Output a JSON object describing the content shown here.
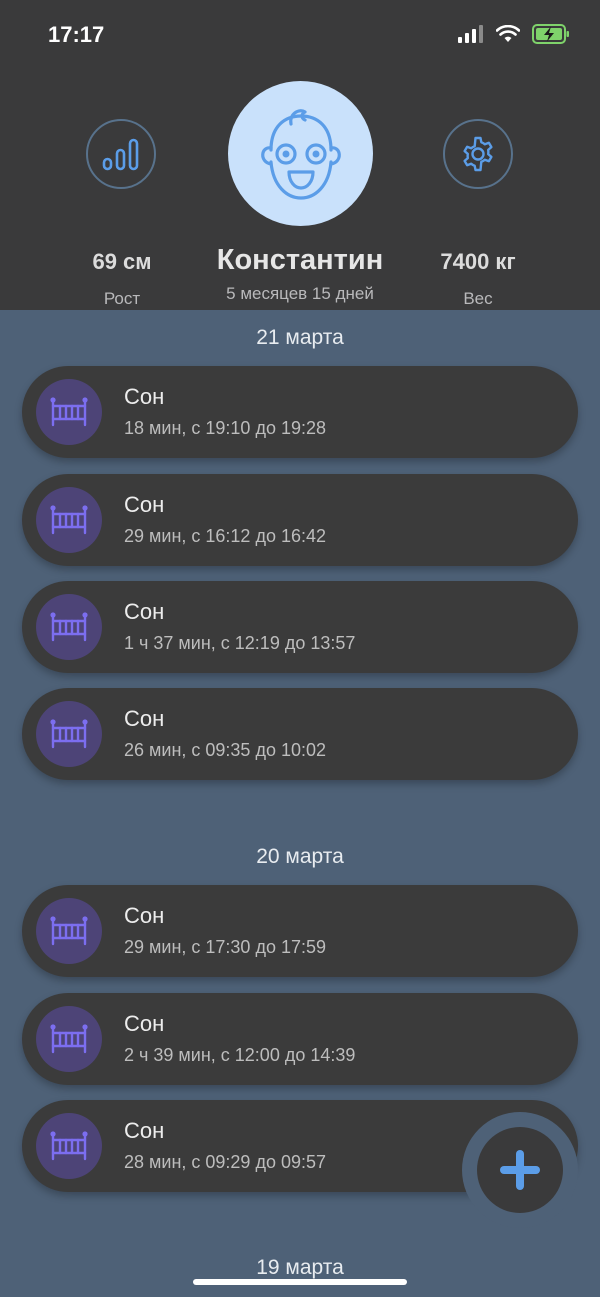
{
  "status": {
    "time": "17:17"
  },
  "profile": {
    "name": "Константин",
    "age": "5 месяцев 15 дней",
    "height_value": "69 см",
    "height_label": "Рост",
    "weight_value": "7400 кг",
    "weight_label": "Вес"
  },
  "groups": [
    {
      "date": "21 марта",
      "items": [
        {
          "title": "Сон",
          "detail": "18 мин, с 19:10 до 19:28"
        },
        {
          "title": "Сон",
          "detail": "29 мин, с 16:12 до 16:42"
        },
        {
          "title": "Сон",
          "detail": "1 ч 37 мин, с 12:19 до 13:57"
        },
        {
          "title": "Сон",
          "detail": "26 мин, с 09:35 до 10:02"
        }
      ]
    },
    {
      "date": "20 марта",
      "items": [
        {
          "title": "Сон",
          "detail": "29 мин, с 17:30 до 17:59"
        },
        {
          "title": "Сон",
          "detail": "2 ч 39 мин, с 12:00 до 14:39"
        },
        {
          "title": "Сон",
          "detail": "28 мин, с 09:29 до 09:57"
        }
      ]
    },
    {
      "date": "19 марта",
      "items": []
    }
  ],
  "colors": {
    "header_bg": "#3a3a3b",
    "list_bg": "#4e6177",
    "accent_blue": "#5b9de8",
    "crib_purple": "#7c6ef0"
  }
}
